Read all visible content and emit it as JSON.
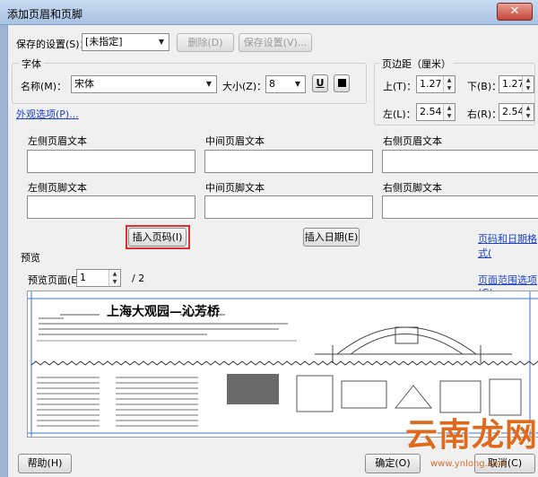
{
  "window": {
    "title": "添加页眉和页脚",
    "close_symbol": "✕"
  },
  "settings": {
    "label": "保存的设置(S)：",
    "value": "[未指定]",
    "delete_label": "删除(D)",
    "save_label": "保存设置(V)..."
  },
  "font": {
    "group_label": "字体",
    "name_label": "名称(M)：",
    "name_value": "宋体",
    "size_label": "大小(Z)：",
    "size_value": "8",
    "underline_symbol": "U"
  },
  "margins": {
    "group_label": "页边距（厘米）",
    "top_label": "上(T)：",
    "top_value": "1.27",
    "bottom_label": "下(B)：",
    "bottom_value": "1.27",
    "left_label": "左(L)：",
    "left_value": "2.54",
    "right_label": "右(R)：",
    "right_value": "2.54"
  },
  "appearance_link": "外观选项(P)...",
  "header_fields": {
    "left_header": "左侧页眉文本",
    "center_header": "中间页眉文本",
    "right_header": "右侧页眉文本",
    "left_footer": "左侧页脚文本",
    "center_footer": "中间页脚文本",
    "right_footer": "右侧页脚文本"
  },
  "insert_page_number": "插入页码(I)",
  "insert_date": "插入日期(E)",
  "page_date_format_link": "页码和日期格式(",
  "preview": {
    "label": "预览",
    "page_label": "预览页面(E)",
    "page_value": "1",
    "page_total": "/ 2",
    "range_link": "页面范围选项(G)...",
    "doc_title": "上海大观园—沁芳桥"
  },
  "footer_buttons": {
    "help": "帮助(H)",
    "ok": "确定(O)",
    "cancel": "取消(C)"
  },
  "watermark": {
    "text": "云南龙网",
    "sub": "www.ynlong.com"
  }
}
